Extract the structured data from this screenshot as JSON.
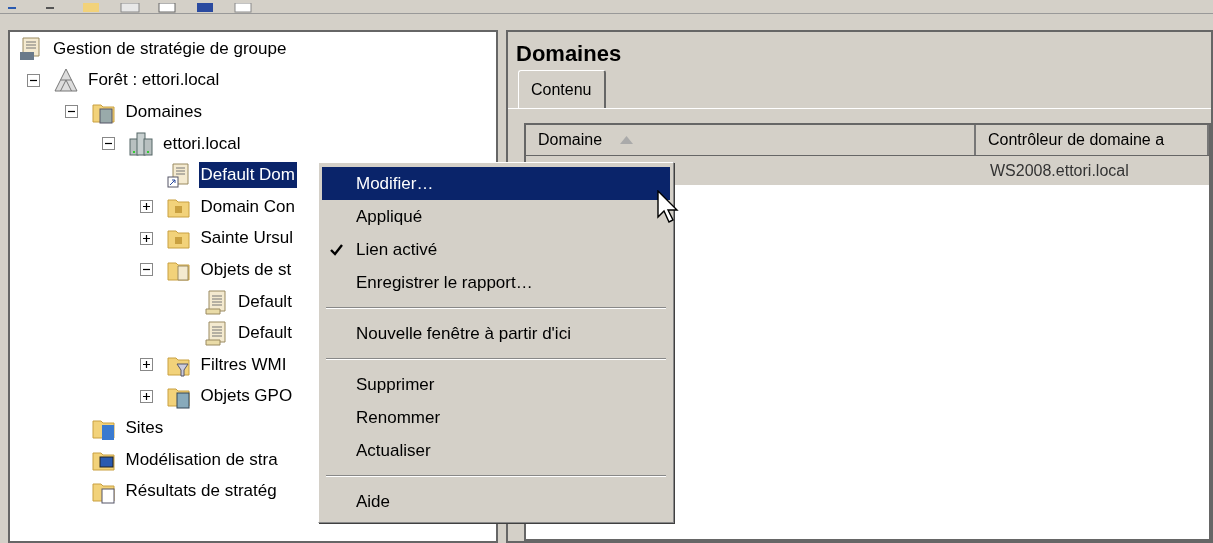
{
  "toolbar": {
    "buttons": [
      {
        "kind": "back"
      },
      {
        "kind": "forward"
      },
      {
        "kind": "folder"
      },
      {
        "kind": "list"
      },
      {
        "kind": "window"
      },
      {
        "kind": "panel"
      },
      {
        "kind": "grid"
      }
    ]
  },
  "tree": {
    "items": [
      {
        "label": "Gestion de stratégie de groupe",
        "kind": "console",
        "selected": false,
        "children": [
          {
            "label": "Forêt : ettori.local",
            "kind": "forest",
            "expanded": true,
            "selected": false,
            "children": [
              {
                "label": "Domaines",
                "kind": "domains",
                "expanded": true,
                "selected": false,
                "children": [
                  {
                    "label": "ettori.local",
                    "kind": "domain",
                    "expanded": true,
                    "selected": false,
                    "children": [
                      {
                        "label": "Default Dom",
                        "kind": "link",
                        "selected": true
                      },
                      {
                        "label": "Domain Con",
                        "kind": "ou",
                        "expanded": false,
                        "selected": false
                      },
                      {
                        "label": "Sainte Ursul",
                        "kind": "ou",
                        "expanded": false,
                        "selected": false
                      },
                      {
                        "label": "Objets de st",
                        "kind": "gpos",
                        "expanded": true,
                        "selected": false,
                        "children": [
                          {
                            "label": "Default",
                            "kind": "gpo",
                            "selected": false
                          },
                          {
                            "label": "Default",
                            "kind": "gpo",
                            "selected": false
                          }
                        ]
                      },
                      {
                        "label": "Filtres WMI",
                        "kind": "filters",
                        "expanded": false,
                        "selected": false
                      },
                      {
                        "label": "Objets GPO",
                        "kind": "starter",
                        "expanded": false,
                        "selected": false
                      }
                    ]
                  }
                ]
              },
              {
                "label": "Sites",
                "kind": "sites",
                "selected": false
              },
              {
                "label": "Modélisation de stra",
                "kind": "modeling",
                "selected": false
              },
              {
                "label": "Résultats de stratég",
                "kind": "results",
                "selected": false
              }
            ]
          }
        ]
      }
    ]
  },
  "details": {
    "title": "Domaines",
    "tabs": [
      {
        "label": "Contenu",
        "selected": true
      }
    ],
    "table": {
      "columns": [
        {
          "label": "Domaine",
          "sorted": true
        },
        {
          "label": "Contrôleur de domaine a"
        }
      ],
      "rows": [
        {
          "selected": true,
          "cells": [
            "",
            "WS2008.ettori.local"
          ]
        }
      ]
    }
  },
  "context_menu": {
    "items": [
      {
        "kind": "command",
        "label": "Modifier…",
        "selected": true,
        "checked": false
      },
      {
        "kind": "command",
        "label": "Appliqué",
        "selected": false,
        "checked": false
      },
      {
        "kind": "command",
        "label": "Lien activé",
        "selected": false,
        "checked": true
      },
      {
        "kind": "command",
        "label": "Enregistrer le rapport…",
        "selected": false,
        "checked": false
      },
      {
        "kind": "separator"
      },
      {
        "kind": "command",
        "label": "Nouvelle fenêtre à partir d'ici",
        "selected": false,
        "checked": false
      },
      {
        "kind": "separator"
      },
      {
        "kind": "command",
        "label": "Supprimer",
        "selected": false,
        "checked": false
      },
      {
        "kind": "command",
        "label": "Renommer",
        "selected": false,
        "checked": false
      },
      {
        "kind": "command",
        "label": "Actualiser",
        "selected": false,
        "checked": false
      },
      {
        "kind": "separator"
      },
      {
        "kind": "command",
        "label": "Aide",
        "selected": false,
        "checked": false
      }
    ]
  }
}
